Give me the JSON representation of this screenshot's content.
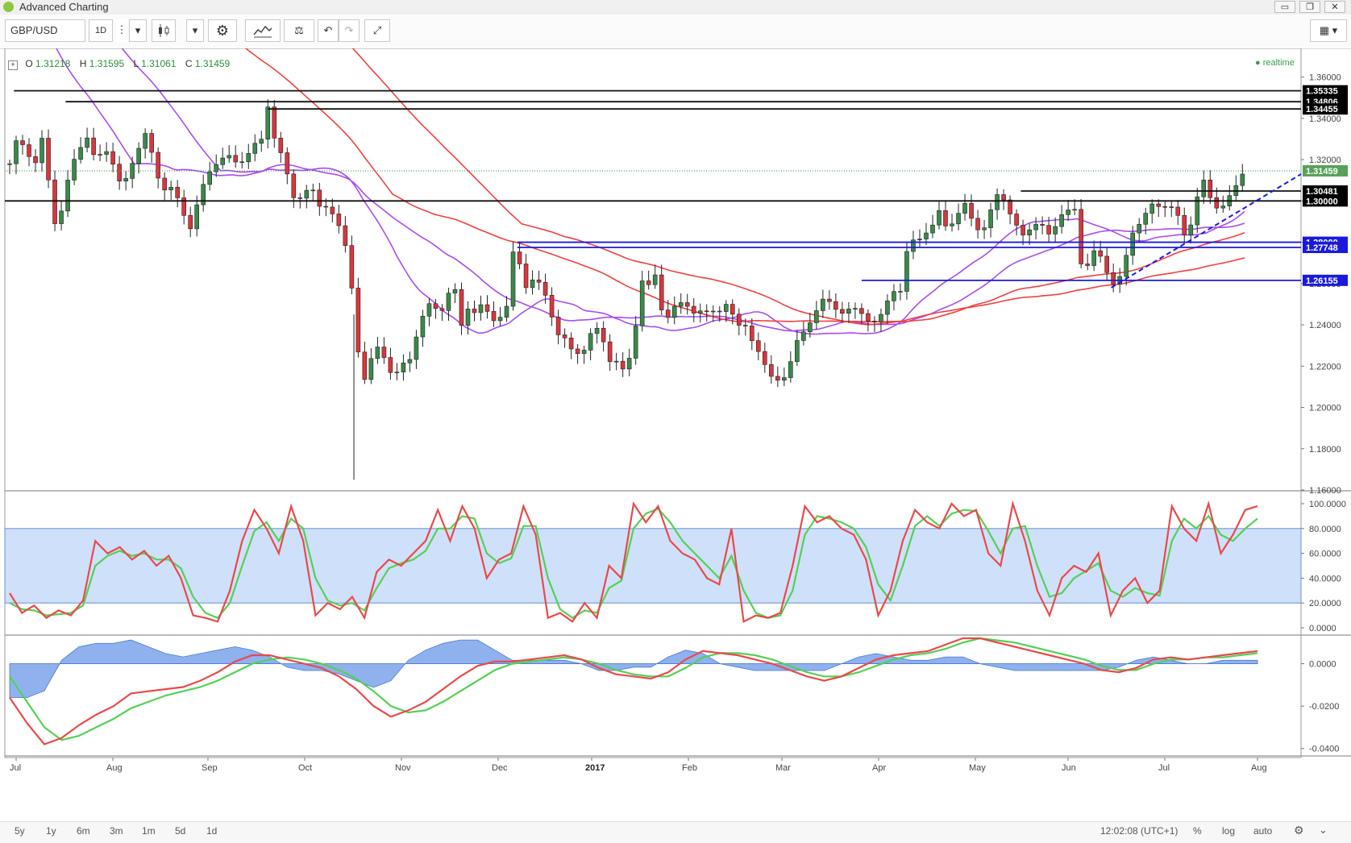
{
  "window": {
    "title": "Advanced Charting",
    "buttons": [
      "▭",
      "❐",
      "✕"
    ]
  },
  "toolbar": {
    "symbol": "GBP/USD",
    "interval": "1D"
  },
  "ohlc": {
    "o_label": "O",
    "o": "1.31218",
    "h_label": "H",
    "h": "1.31595",
    "l_label": "L",
    "l": "1.31061",
    "c_label": "C",
    "c": "1.31459"
  },
  "realtime_label": "realtime",
  "bottom": {
    "ranges": [
      "5y",
      "1y",
      "6m",
      "3m",
      "1m",
      "5d",
      "1d"
    ],
    "clock": "12:02:08 (UTC+1)",
    "percent": "%",
    "log": "log",
    "auto": "auto"
  },
  "colors": {
    "bull": "#3a8a4a",
    "bear": "#d9363e",
    "ma_purple": "#a64df0",
    "ma_red": "#f04040",
    "support_blue": "#1a1adc",
    "stoch_k": "#e84a4a",
    "stoch_d": "#55d055",
    "stoch_band": "#cfe0fb",
    "macd_hist": "#6a98e8"
  },
  "chart_data": [
    {
      "type": "candlestick",
      "title": "GBP/USD",
      "x_tick_labels": [
        "Jul",
        "Aug",
        "Sep",
        "Oct",
        "Nov",
        "Dec",
        "2017",
        "Feb",
        "Mar",
        "Apr",
        "May",
        "Jun",
        "Jul",
        "Aug"
      ],
      "y_tick_labels": [
        "1.36000",
        "1.34000",
        "1.32000",
        "1.30000",
        "1.28000",
        "1.26000",
        "1.24000",
        "1.22000",
        "1.20000",
        "1.18000",
        "1.16000"
      ],
      "ylim": [
        1.16,
        1.37
      ],
      "last_price": "1.31459",
      "price_levels": [
        {
          "value": 1.35335,
          "label": "1.35335",
          "style": "black"
        },
        {
          "value": 1.34806,
          "label": "1.34806",
          "style": "black"
        },
        {
          "value": 1.34455,
          "label": "1.34455",
          "style": "black"
        },
        {
          "value": 1.30481,
          "label": "1.30481",
          "style": "black"
        },
        {
          "value": 1.3,
          "label": "1.30000",
          "style": "black"
        },
        {
          "value": 1.28,
          "label": "1.28000",
          "style": "blue"
        },
        {
          "value": 1.27748,
          "label": "1.27748",
          "style": "blue"
        },
        {
          "value": 1.26155,
          "label": "1.26155",
          "style": "blue"
        }
      ],
      "close_path": [
        [
          0,
          1.318
        ],
        [
          4,
          1.336
        ],
        [
          8,
          1.322
        ],
        [
          12,
          1.316
        ],
        [
          16,
          1.334
        ],
        [
          20,
          1.29
        ],
        [
          24,
          1.295
        ],
        [
          28,
          1.312
        ],
        [
          32,
          1.325
        ],
        [
          36,
          1.333
        ],
        [
          40,
          1.32
        ],
        [
          46,
          1.322
        ],
        [
          52,
          1.31
        ],
        [
          56,
          1.315
        ],
        [
          60,
          1.323
        ],
        [
          64,
          1.335
        ],
        [
          68,
          1.316
        ],
        [
          72,
          1.305
        ],
        [
          76,
          1.304
        ],
        [
          80,
          1.296
        ],
        [
          84,
          1.289
        ],
        [
          88,
          1.302
        ],
        [
          92,
          1.31
        ],
        [
          96,
          1.318
        ],
        [
          100,
          1.325
        ],
        [
          104,
          1.322
        ],
        [
          106,
          1.313
        ],
        [
          110,
          1.32
        ],
        [
          114,
          1.33
        ],
        [
          116,
          1.328
        ],
        [
          118,
          1.336
        ],
        [
          120,
          1.345
        ],
        [
          122,
          1.33
        ],
        [
          126,
          1.322
        ],
        [
          128,
          1.318
        ],
        [
          132,
          1.304
        ],
        [
          136,
          1.301
        ],
        [
          140,
          1.305
        ],
        [
          144,
          1.298
        ],
        [
          148,
          1.3
        ],
        [
          152,
          1.29
        ],
        [
          156,
          1.276
        ],
        [
          158,
          1.27
        ],
        [
          160,
          1.245
        ],
        [
          164,
          1.213
        ],
        [
          166,
          1.218
        ],
        [
          170,
          1.228
        ],
        [
          174,
          1.223
        ],
        [
          178,
          1.217
        ],
        [
          182,
          1.222
        ],
        [
          186,
          1.221
        ],
        [
          190,
          1.236
        ],
        [
          194,
          1.254
        ],
        [
          198,
          1.249
        ],
        [
          202,
          1.244
        ],
        [
          206,
          1.262
        ],
        [
          210,
          1.242
        ],
        [
          214,
          1.252
        ],
        [
          216,
          1.245
        ],
        [
          220,
          1.248
        ],
        [
          224,
          1.243
        ],
        [
          228,
          1.246
        ],
        [
          232,
          1.25
        ],
        [
          234,
          1.273
        ],
        [
          238,
          1.266
        ],
        [
          240,
          1.259
        ],
        [
          244,
          1.266
        ],
        [
          248,
          1.257
        ],
        [
          250,
          1.248
        ],
        [
          254,
          1.235
        ],
        [
          258,
          1.236
        ],
        [
          262,
          1.228
        ],
        [
          266,
          1.222
        ],
        [
          270,
          1.235
        ],
        [
          274,
          1.242
        ],
        [
          278,
          1.226
        ],
        [
          280,
          1.218
        ],
        [
          284,
          1.222
        ],
        [
          286,
          1.212
        ],
        [
          288,
          1.225
        ],
        [
          290,
          1.236
        ],
        [
          292,
          1.248
        ],
        [
          294,
          1.262
        ],
        [
          298,
          1.256
        ],
        [
          300,
          1.262
        ],
        [
          302,
          1.248
        ],
        [
          306,
          1.246
        ],
        [
          310,
          1.252
        ],
        [
          314,
          1.247
        ],
        [
          318,
          1.245
        ],
        [
          322,
          1.25
        ],
        [
          326,
          1.247
        ],
        [
          330,
          1.244
        ],
        [
          334,
          1.25
        ],
        [
          338,
          1.243
        ],
        [
          342,
          1.24
        ],
        [
          344,
          1.232
        ],
        [
          348,
          1.225
        ],
        [
          352,
          1.22
        ],
        [
          356,
          1.215
        ],
        [
          360,
          1.213
        ],
        [
          364,
          1.222
        ],
        [
          366,
          1.232
        ],
        [
          370,
          1.241
        ],
        [
          374,
          1.245
        ],
        [
          378,
          1.25
        ],
        [
          382,
          1.25
        ],
        [
          386,
          1.248
        ],
        [
          390,
          1.248
        ],
        [
          394,
          1.245
        ],
        [
          398,
          1.242
        ],
        [
          402,
          1.244
        ],
        [
          406,
          1.247
        ],
        [
          410,
          1.253
        ],
        [
          414,
          1.256
        ],
        [
          418,
          1.285
        ],
        [
          420,
          1.283
        ],
        [
          424,
          1.28
        ],
        [
          428,
          1.284
        ],
        [
          432,
          1.297
        ],
        [
          436,
          1.288
        ],
        [
          440,
          1.29
        ],
        [
          444,
          1.297
        ],
        [
          448,
          1.291
        ],
        [
          452,
          1.286
        ],
        [
          456,
          1.294
        ],
        [
          460,
          1.303
        ],
        [
          464,
          1.298
        ],
        [
          468,
          1.29
        ],
        [
          472,
          1.28
        ],
        [
          476,
          1.287
        ],
        [
          480,
          1.29
        ],
        [
          484,
          1.285
        ],
        [
          488,
          1.29
        ],
        [
          492,
          1.294
        ],
        [
          496,
          1.298
        ],
        [
          498,
          1.272
        ],
        [
          500,
          1.268
        ],
        [
          504,
          1.274
        ],
        [
          508,
          1.27
        ],
        [
          512,
          1.261
        ],
        [
          516,
          1.265
        ],
        [
          520,
          1.275
        ],
        [
          522,
          1.282
        ],
        [
          526,
          1.29
        ],
        [
          530,
          1.302
        ],
        [
          534,
          1.297
        ],
        [
          538,
          1.294
        ],
        [
          542,
          1.297
        ],
        [
          546,
          1.286
        ],
        [
          550,
          1.29
        ],
        [
          554,
          1.31
        ],
        [
          558,
          1.302
        ],
        [
          562,
          1.298
        ],
        [
          566,
          1.3
        ],
        [
          570,
          1.305
        ],
        [
          574,
          1.315
        ]
      ]
    },
    {
      "type": "line",
      "title": "Stochastic",
      "y_tick_labels": [
        "100.0000",
        "80.0000",
        "60.0000",
        "40.0000",
        "20.0000",
        "0.0000"
      ],
      "ylim": [
        0,
        100
      ],
      "band": [
        20,
        80
      ],
      "series": [
        {
          "values": [
            28,
            12,
            18,
            8,
            14,
            10,
            22,
            70,
            60,
            65,
            55,
            62,
            50,
            58,
            40,
            10,
            8,
            5,
            30,
            70,
            95,
            80,
            60,
            98,
            70,
            10,
            20,
            15,
            25,
            8,
            45,
            55,
            50,
            60,
            70,
            95,
            70,
            98,
            80,
            40,
            55,
            60,
            98,
            75,
            8,
            12,
            5,
            20,
            8,
            50,
            40,
            100,
            85,
            98,
            70,
            60,
            55,
            40,
            35,
            80,
            5,
            10,
            8,
            12,
            50,
            98,
            85,
            90,
            80,
            75,
            55,
            10,
            30,
            70,
            95,
            85,
            80,
            100,
            90,
            95,
            60,
            50,
            100,
            70,
            30,
            10,
            40,
            50,
            45,
            60,
            10,
            30,
            40,
            20,
            30,
            98,
            80,
            70,
            100,
            60,
            75,
            95,
            98
          ]
        },
        {
          "values": [
            20,
            15,
            14,
            10,
            11,
            12,
            18,
            50,
            58,
            62,
            58,
            60,
            55,
            55,
            48,
            25,
            12,
            8,
            20,
            50,
            78,
            85,
            70,
            88,
            80,
            40,
            22,
            18,
            20,
            14,
            32,
            48,
            52,
            55,
            62,
            80,
            80,
            90,
            88,
            60,
            52,
            56,
            82,
            82,
            40,
            15,
            8,
            14,
            12,
            32,
            38,
            80,
            92,
            96,
            85,
            70,
            60,
            50,
            40,
            58,
            30,
            12,
            8,
            10,
            30,
            75,
            90,
            88,
            85,
            80,
            65,
            35,
            22,
            50,
            82,
            90,
            82,
            92,
            95,
            94,
            78,
            60,
            80,
            82,
            50,
            25,
            28,
            40,
            46,
            52,
            30,
            25,
            32,
            28,
            26,
            70,
            88,
            80,
            90,
            75,
            70,
            80,
            88
          ]
        }
      ]
    },
    {
      "type": "line",
      "title": "MACD",
      "y_tick_labels": [
        "0.0000",
        "-0.0200",
        "-0.0400"
      ],
      "ylim": [
        -0.042,
        0.012
      ],
      "series": [
        {
          "values": [
            -0.016,
            -0.028,
            -0.038,
            -0.035,
            -0.029,
            -0.024,
            -0.02,
            -0.014,
            -0.013,
            -0.012,
            -0.011,
            -0.008,
            -0.004,
            0.001,
            0.004,
            0.004,
            0.002,
            0.0,
            -0.002,
            -0.006,
            -0.012,
            -0.02,
            -0.025,
            -0.022,
            -0.018,
            -0.012,
            -0.006,
            -0.001,
            0.001,
            0.001,
            0.002,
            0.003,
            0.004,
            0.002,
            -0.002,
            -0.005,
            -0.006,
            -0.007,
            -0.004,
            0.002,
            0.006,
            0.005,
            0.004,
            0.002,
            0.0,
            -0.003,
            -0.006,
            -0.008,
            -0.006,
            -0.002,
            0.002,
            0.004,
            0.005,
            0.006,
            0.009,
            0.012,
            0.012,
            0.01,
            0.008,
            0.006,
            0.004,
            0.002,
            0.0,
            -0.003,
            -0.004,
            -0.002,
            0.002,
            0.003,
            0.002,
            0.003,
            0.004,
            0.005,
            0.006
          ]
        },
        {
          "values": [
            -0.006,
            -0.018,
            -0.03,
            -0.036,
            -0.034,
            -0.03,
            -0.026,
            -0.021,
            -0.018,
            -0.015,
            -0.013,
            -0.011,
            -0.008,
            -0.004,
            0.0,
            0.002,
            0.003,
            0.002,
            0.0,
            -0.003,
            -0.007,
            -0.013,
            -0.02,
            -0.023,
            -0.022,
            -0.018,
            -0.013,
            -0.008,
            -0.003,
            0.0,
            0.001,
            0.002,
            0.003,
            0.002,
            0.0,
            -0.003,
            -0.005,
            -0.006,
            -0.006,
            -0.002,
            0.003,
            0.005,
            0.005,
            0.004,
            0.002,
            -0.001,
            -0.004,
            -0.006,
            -0.006,
            -0.004,
            -0.001,
            0.002,
            0.004,
            0.005,
            0.007,
            0.01,
            0.012,
            0.011,
            0.01,
            0.008,
            0.006,
            0.004,
            0.002,
            -0.001,
            -0.003,
            -0.003,
            0.0,
            0.002,
            0.002,
            0.003,
            0.003,
            0.004,
            0.005
          ]
        }
      ]
    }
  ]
}
